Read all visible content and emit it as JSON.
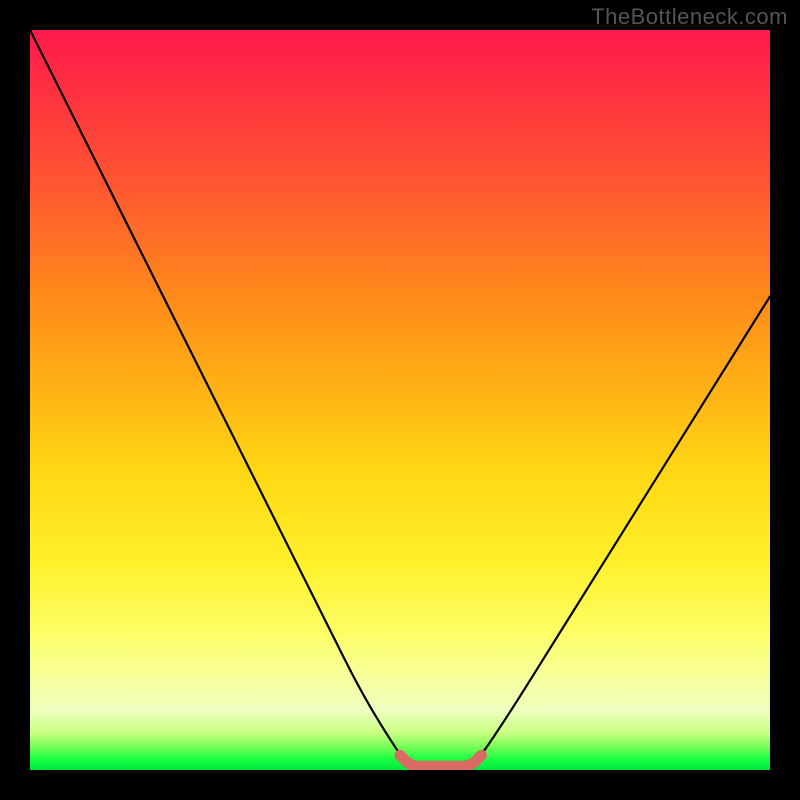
{
  "watermark": "TheBottleneck.com",
  "chart_data": {
    "type": "line",
    "title": "",
    "xlabel": "",
    "ylabel": "",
    "x": [
      0,
      5,
      10,
      15,
      20,
      25,
      30,
      35,
      40,
      45,
      50,
      51,
      52,
      53,
      54,
      55,
      56,
      57,
      58,
      59,
      60,
      61,
      65,
      70,
      75,
      80,
      85,
      90,
      95,
      100
    ],
    "values": [
      100,
      90,
      80,
      70,
      60,
      50,
      40,
      30,
      20,
      10,
      2,
      1,
      0.5,
      0.5,
      0.5,
      0.5,
      0.5,
      0.5,
      0.5,
      0.5,
      1,
      2,
      8,
      16,
      24,
      32,
      40,
      48,
      56,
      64
    ],
    "xlim": [
      0,
      100
    ],
    "ylim": [
      0,
      100
    ],
    "highlight_range_x": [
      50,
      61
    ],
    "highlight_color": "#d96b63",
    "gradient_stops": [
      {
        "pct": 0,
        "color": "#ff1a4d"
      },
      {
        "pct": 50,
        "color": "#ffd814"
      },
      {
        "pct": 92,
        "color": "#eeffc0"
      },
      {
        "pct": 100,
        "color": "#00e840"
      }
    ]
  }
}
